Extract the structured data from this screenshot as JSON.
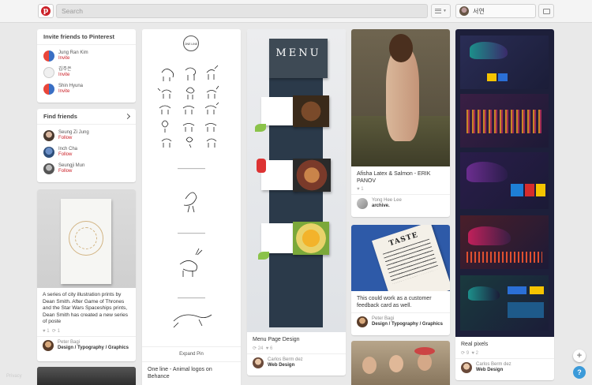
{
  "header": {
    "search_placeholder": "Search",
    "user_name": "서연"
  },
  "invite": {
    "title": "Invite friends to Pinterest",
    "people": [
      {
        "name": "Jung Ran Kim",
        "action": "Invite"
      },
      {
        "name": "김주은",
        "action": "Invite"
      },
      {
        "name": "Shin Hyuna",
        "action": "Invite"
      }
    ]
  },
  "find": {
    "title": "Find friends",
    "people": [
      {
        "name": "Seung Zi Jung",
        "action": "Follow"
      },
      {
        "name": "Inch Cha",
        "action": "Follow"
      },
      {
        "name": "Seungji Mun",
        "action": "Follow"
      }
    ]
  },
  "pins": {
    "poster": {
      "description": "A series of city illustration prints by Dean Smith. After Game of Thrones and the Star Wars Spaceships prints, Dean Smith has created a new series of poste",
      "likes": "1",
      "repins": "1",
      "pinner": "Peter Bagi",
      "board": "Design / Typography / Graphics"
    },
    "animals": {
      "expand": "Expand Pin",
      "description": "One line - Animal logos on Behance",
      "logo_text": "ONE LINE"
    },
    "menu": {
      "menu_title": "MENU",
      "description": "Menu Page Design",
      "repins": "24",
      "likes": "6",
      "pinner": "Carlos Berm dez",
      "board": "Web Design"
    },
    "photo": {
      "description": "Afisha Latex & Salmon - ERIK PANOV",
      "likes": "1",
      "pinner": "Yong Hee Lee",
      "board": "archive."
    },
    "taste": {
      "taste_word": "TASTE",
      "description": "This could work as a customer feedback card as well.",
      "pinner": "Peter Bagi",
      "board": "Design / Typography / Graphics"
    },
    "pixels": {
      "description": "Real pixels",
      "repins": "9",
      "likes": "2",
      "pinner": "Carlos Berm dez",
      "board": "Web Design"
    }
  },
  "footer": {
    "privacy": "Privacy"
  },
  "colors": {
    "brand_red": "#cb2027",
    "help_blue": "#3b9ad9"
  }
}
